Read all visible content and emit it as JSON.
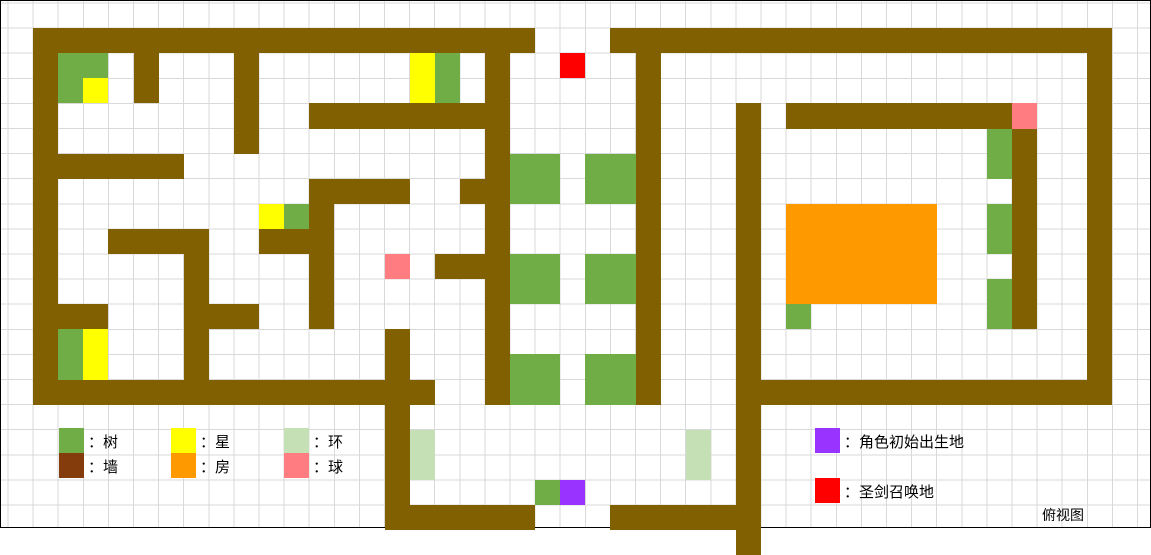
{
  "colors": {
    "tree": "#70ad47",
    "wall": "#806000",
    "wall_legend": "#843c0c",
    "star": "#ffff00",
    "house": "#ff9900",
    "ring": "#c5e0b4",
    "ball": "#ff7c80",
    "spawn": "#9933ff",
    "sword": "#ff0000",
    "grid": "#d9d9d9"
  },
  "legend": {
    "tree": "：树",
    "wall": "：墙",
    "star": "：星",
    "house": "：房",
    "ring": "：环",
    "ball": "：球",
    "spawn": "：角色初始出生地",
    "sword": "：圣剑召唤地"
  },
  "view_label": "俯视图"
}
